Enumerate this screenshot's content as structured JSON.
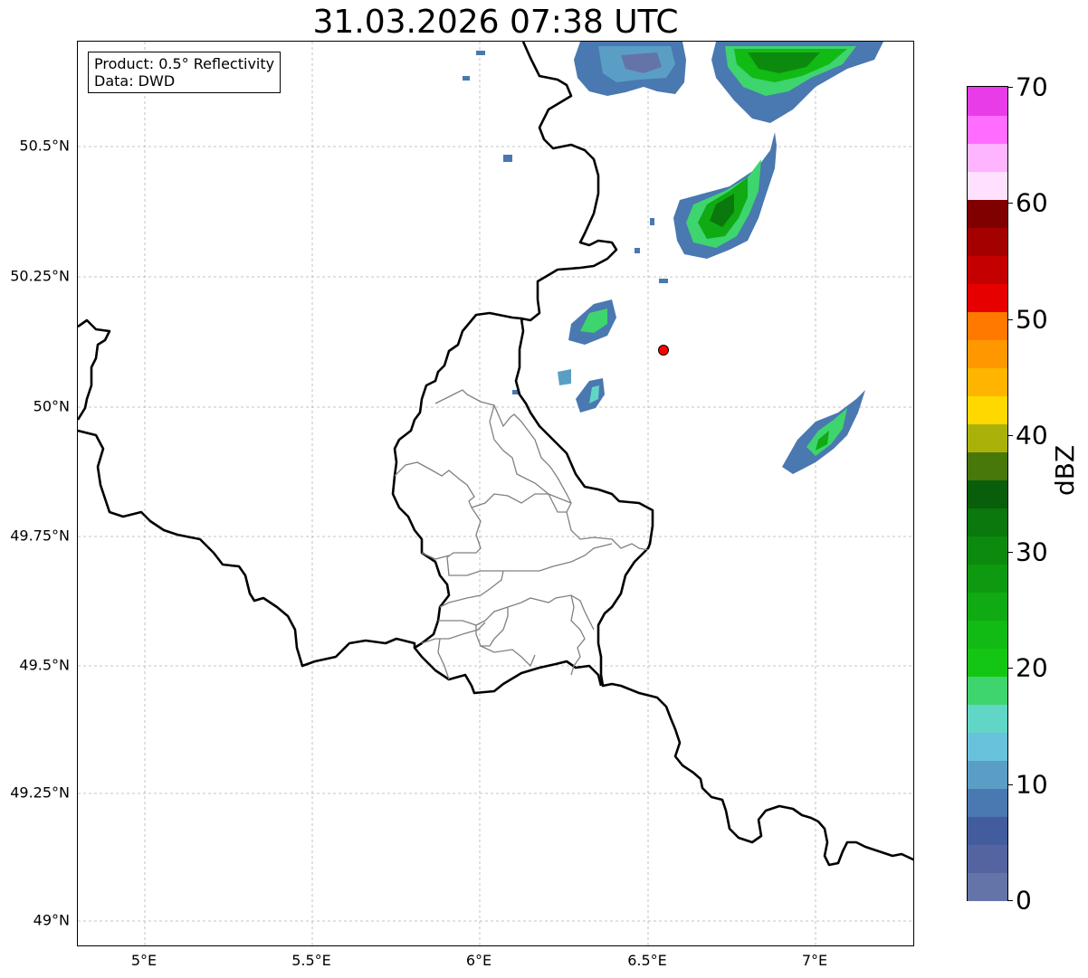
{
  "title": "31.03.2026 07:38 UTC",
  "info": {
    "product": "Product: 0.5° Reflectivity",
    "data": "Data: DWD"
  },
  "axes": {
    "lat_labels": [
      "50.5°N",
      "50.25°N",
      "50°N",
      "49.75°N",
      "49.5°N",
      "49.25°N",
      "49°N"
    ],
    "lon_labels": [
      "5°E",
      "5.5°E",
      "6°E",
      "6.5°E",
      "7°E"
    ]
  },
  "colorbar": {
    "label": "dBZ",
    "range": [
      0,
      70
    ],
    "tick_labels": [
      "0",
      "10",
      "20",
      "30",
      "40",
      "50",
      "60",
      "70"
    ],
    "colors": [
      "#6474a8",
      "#5464a0",
      "#425c9e",
      "#4a78b0",
      "#5a9ec6",
      "#68c2dc",
      "#62d6c6",
      "#3ed46e",
      "#14c614",
      "#12ba14",
      "#10aa12",
      "#0e9a10",
      "#0c8a0e",
      "#0a780c",
      "#085e0a",
      "#48780a",
      "#aab20a",
      "#ffd800",
      "#ffb400",
      "#ff9800",
      "#ff7800",
      "#e60000",
      "#c40000",
      "#a40000",
      "#800000",
      "#ffe0ff",
      "#ffb4ff",
      "#ff6cff",
      "#e83ce8"
    ]
  },
  "map": {
    "marker_color": "#ff0000",
    "border_color": "#000000",
    "canton_color": "#808080",
    "grid_color": "#b0b0b0"
  }
}
